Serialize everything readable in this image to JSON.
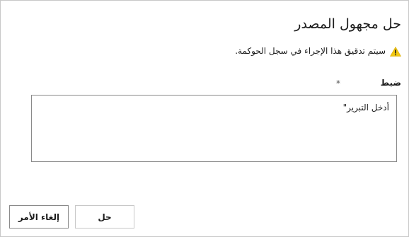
{
  "dialog": {
    "title": "حل مجهول المصدر",
    "warning": {
      "icon": "warning-icon",
      "text": "سيتم تدقيق هذا الإجراء في سجل الحوكمة.",
      "icon_color": "#f2c811"
    },
    "field": {
      "label": "ضبط",
      "required_mark": "*",
      "placeholder": "أدخل التبرير\"",
      "value": ""
    },
    "buttons": {
      "resolve_label": "حل",
      "cancel_label": "إلغاء الأمر"
    }
  }
}
